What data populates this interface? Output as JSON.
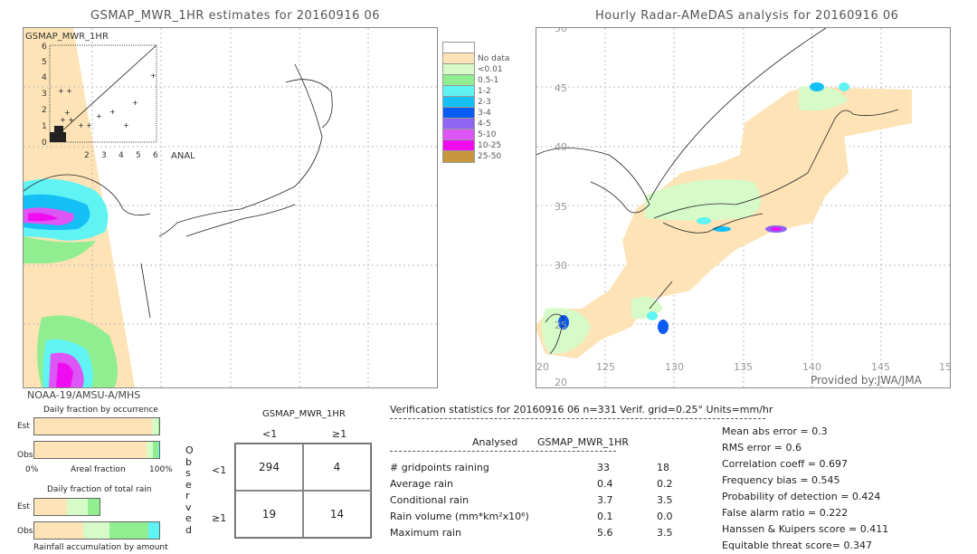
{
  "left_map": {
    "title": "GSMAP_MWR_1HR estimates for 20160916 06",
    "scatter_ylabel": "GSMAP_MWR_1HR",
    "scatter_xlabel": "ANAL",
    "scatter_ticks": [
      "0",
      "1",
      "2",
      "3",
      "4",
      "5",
      "6"
    ],
    "satellite": "NOAA-19/AMSU-A/MHS"
  },
  "right_map": {
    "title": "Hourly Radar-AMeDAS analysis for 20160916 06",
    "lat_ticks": [
      "50",
      "45",
      "40",
      "35",
      "30",
      "25",
      "20"
    ],
    "lon_ticks": [
      "20",
      "125",
      "130",
      "135",
      "140",
      "145",
      "15"
    ],
    "credit": "Provided by:JWA/JMA"
  },
  "legend": [
    {
      "label": "",
      "color": "#ffffff"
    },
    {
      "label": "No data",
      "color": "#fde3b5"
    },
    {
      "label": "<0.01",
      "color": "#d7fbc8"
    },
    {
      "label": "0.5-1",
      "color": "#90ee90"
    },
    {
      "label": "1-2",
      "color": "#5ff3f3"
    },
    {
      "label": "2-3",
      "color": "#14bff5"
    },
    {
      "label": "3-4",
      "color": "#0a5cf5"
    },
    {
      "label": "4-5",
      "color": "#8f64f0"
    },
    {
      "label": "5-10",
      "color": "#dd55f5"
    },
    {
      "label": "10-25",
      "color": "#f00cf0"
    },
    {
      "label": "25-50",
      "color": "#c8963c"
    }
  ],
  "fraction_charts": {
    "occurrence_title": "Daily fraction by occurrence",
    "est_label": "Est",
    "obs_label": "Obs",
    "axis_left": "0%",
    "axis_mid": "Areal fraction",
    "axis_right": "100%",
    "occurrence_est": [
      {
        "pct": 94.5,
        "color": "#fde3b5"
      },
      {
        "pct": 4.5,
        "color": "#d7fbc8"
      },
      {
        "pct": 1,
        "color": "#90ee90"
      }
    ],
    "occurrence_obs": [
      {
        "pct": 90,
        "color": "#fde3b5"
      },
      {
        "pct": 5,
        "color": "#d7fbc8"
      },
      {
        "pct": 4,
        "color": "#90ee90"
      },
      {
        "pct": 1,
        "color": "#5ff3f3"
      }
    ],
    "total_title": "Daily fraction of total rain",
    "total_est": [
      {
        "pct": 26,
        "color": "#fde3b5"
      },
      {
        "pct": 17,
        "color": "#d7fbc8"
      },
      {
        "pct": 9,
        "color": "#90ee90"
      }
    ],
    "total_obs": [
      {
        "pct": 39,
        "color": "#fde3b5"
      },
      {
        "pct": 21,
        "color": "#d7fbc8"
      },
      {
        "pct": 31,
        "color": "#90ee90"
      },
      {
        "pct": 9,
        "color": "#5ff3f3"
      }
    ],
    "accum_title": "Rainfall accumulation by amount"
  },
  "contingency": {
    "title": "GSMAP_MWR_1HR",
    "col_labels": [
      "<1",
      "≥1"
    ],
    "row_labels": [
      "<1",
      "≥1"
    ],
    "side_label": "Observed",
    "values": [
      [
        "294",
        "4"
      ],
      [
        "19",
        "14"
      ]
    ]
  },
  "verification": {
    "header": "Verification statistics for 20160916 06   n=331   Verif. grid=0.25°   Units=mm/hr",
    "col_analysed": "Analysed",
    "col_est": "GSMAP_MWR_1HR",
    "rows": [
      {
        "label": "# gridpoints raining",
        "a": "33",
        "e": "18"
      },
      {
        "label": "Average rain",
        "a": "0.4",
        "e": "0.2"
      },
      {
        "label": "Conditional rain",
        "a": "3.7",
        "e": "3.5"
      },
      {
        "label": "Rain volume (mm*km²x10⁶)",
        "a": "0.1",
        "e": "0.0"
      },
      {
        "label": "Maximum rain",
        "a": "5.6",
        "e": "3.5"
      }
    ],
    "scores": [
      "Mean abs error = 0.3",
      "RMS error = 0.6",
      "Correlation coeff = 0.697",
      "Frequency bias = 0.545",
      "Probability of detection = 0.424",
      "False alarm ratio = 0.222",
      "Hanssen & Kuipers score = 0.411",
      "Equitable threat score= 0.347"
    ]
  }
}
